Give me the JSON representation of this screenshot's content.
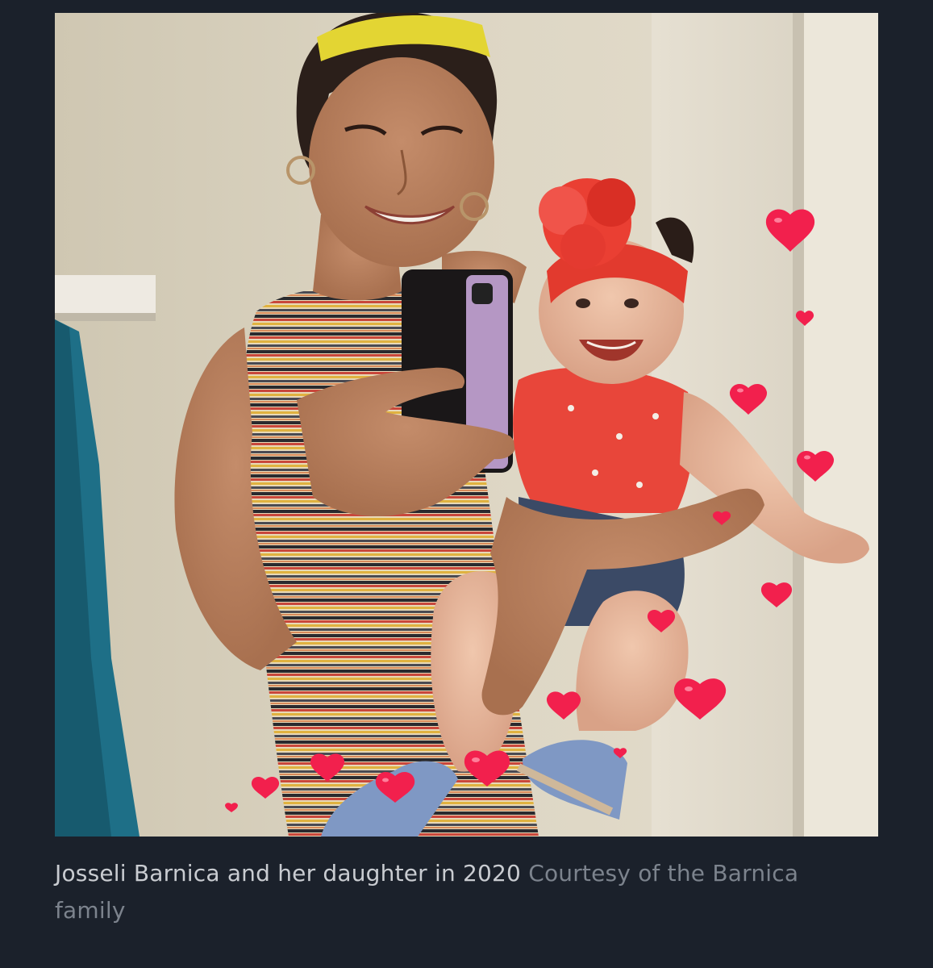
{
  "photo": {
    "description_icon": "photo-of-mother-and-baby"
  },
  "caption": {
    "text": "Josseli Barnica and her daughter in 2020",
    "credit": "Courtesy of the Barnica family"
  },
  "colors": {
    "background": "#1b212b",
    "caption_text": "#c9ccd1",
    "credit_text": "#7c838d",
    "heart": "#f2204d"
  }
}
